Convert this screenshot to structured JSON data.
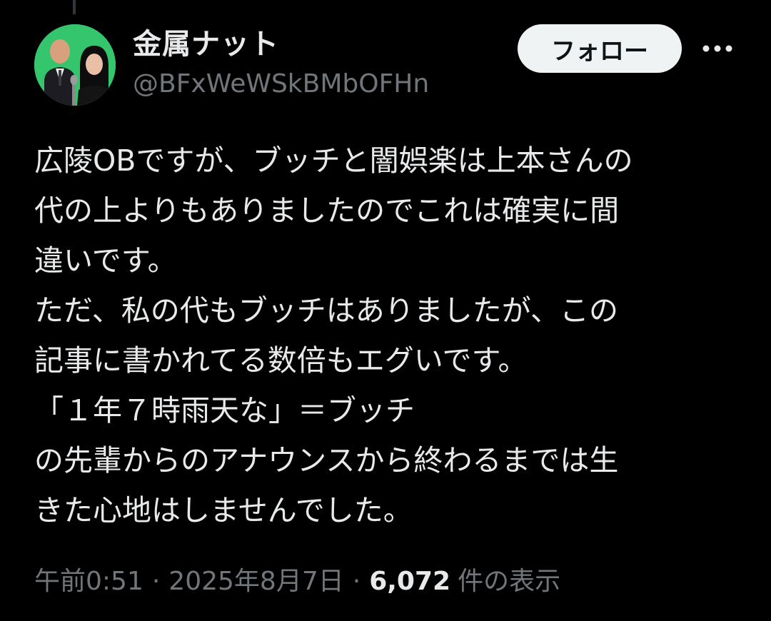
{
  "user": {
    "display_name": "金属ナット",
    "handle": "@BFxWeWSkBMbOFHn",
    "avatar_icon": "profile-photo"
  },
  "actions": {
    "follow_label": "フォロー",
    "more_icon": "more-horizontal-icon"
  },
  "tweet": {
    "text": "広陵OBですが、ブッチと闇娯楽は上本さんの\n代の上よりもありましたのでこれは確実に間\n違いです。\nただ、私の代もブッチはありましたが、この\n記事に書かれてる数倍もエグいです。\n「１年７時雨天な」＝ブッチ\nの先輩からのアナウンスから終わるまでは生\nきた心地はしませんでした。",
    "time": "午前0:51",
    "date": "2025年8月7日",
    "separator": "·",
    "views_count": "6,072",
    "views_label": "件の表示"
  },
  "colors": {
    "background": "#000000",
    "text_primary": "#e7e9ea",
    "text_secondary": "#71767b",
    "follow_bg": "#eff3f4",
    "avatar_bg": "#35c66d"
  }
}
